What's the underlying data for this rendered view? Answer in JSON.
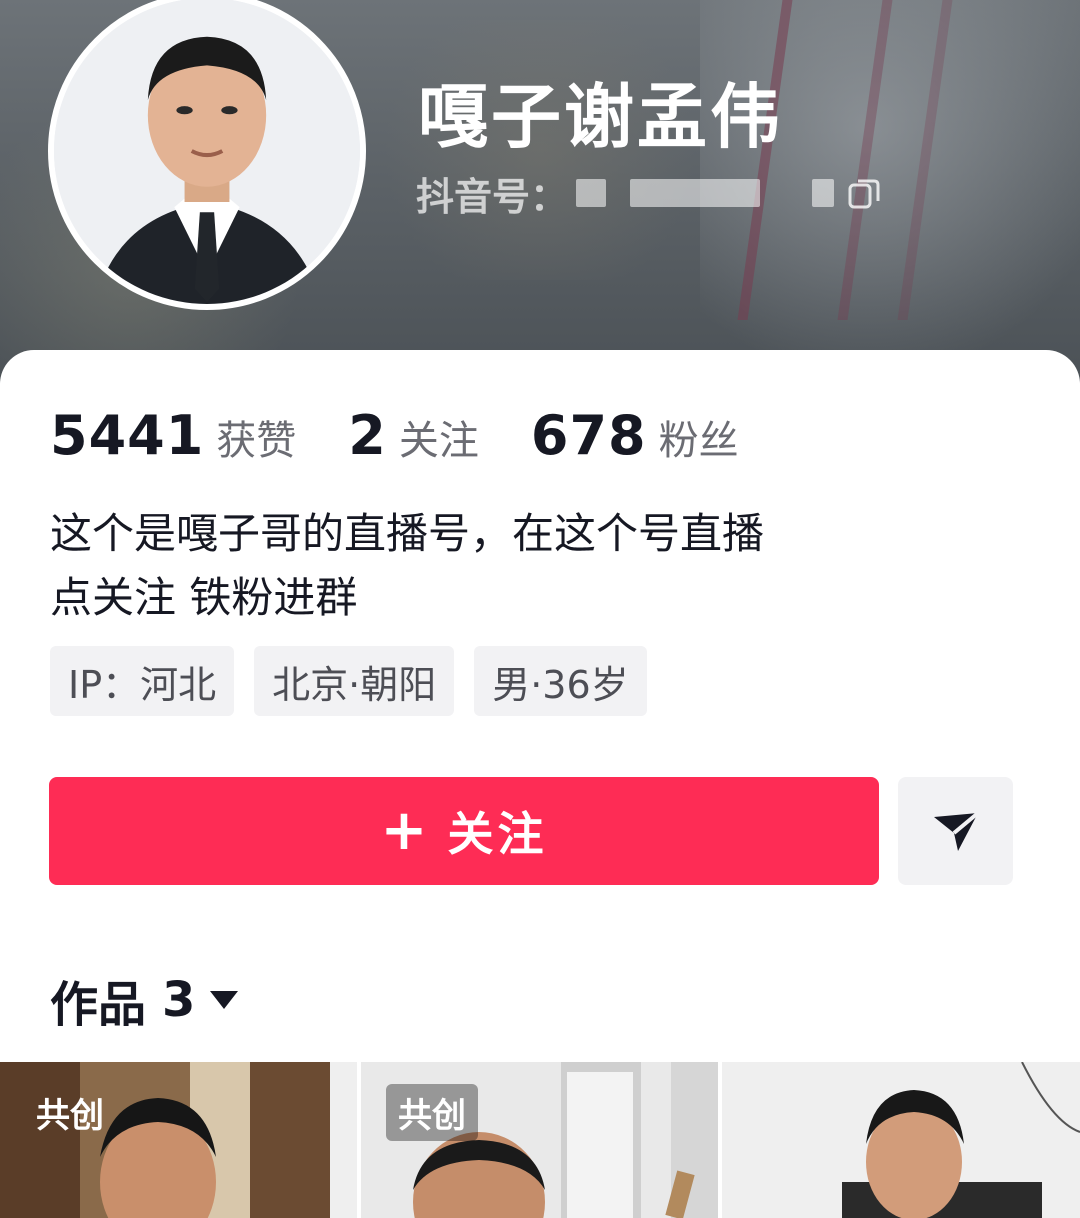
{
  "profile": {
    "name": "嘎子谢孟伟",
    "id_label": "抖音号：",
    "stats": [
      {
        "num": "5441",
        "label": "获赞"
      },
      {
        "num": "2",
        "label": "关注"
      },
      {
        "num": "678",
        "label": "粉丝"
      }
    ],
    "bio_lines": [
      "这个是嘎子哥的直播号，在这个号直播",
      "点关注 铁粉进群"
    ],
    "tags": [
      "IP：河北",
      "北京·朝阳",
      "男·36岁"
    ]
  },
  "actions": {
    "follow_plus": "+",
    "follow_label": "关注"
  },
  "works": {
    "title": "作品",
    "count": "3",
    "items": [
      {
        "badge": "共创"
      },
      {
        "badge": "共创"
      },
      {
        "badge": ""
      }
    ]
  },
  "colors": {
    "accent": "#fe2c55",
    "text_primary": "#161823",
    "text_secondary": "#6b6c73",
    "tag_bg": "#f2f2f4"
  },
  "icons": {
    "copy": "copy-icon",
    "share": "send-icon",
    "caret": "caret-down-icon"
  }
}
